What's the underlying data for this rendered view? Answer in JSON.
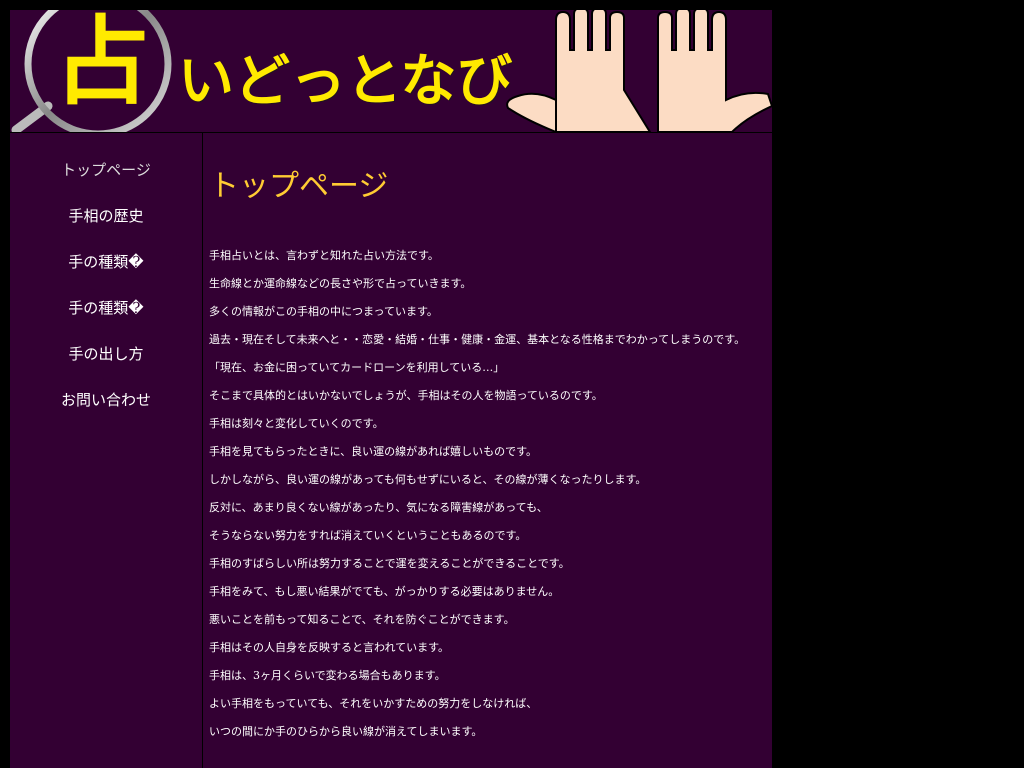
{
  "site": {
    "logo_kanji": "占",
    "logo_text": "いどっとなび",
    "brand_color": "#ffea00",
    "background": "#330033"
  },
  "sidebar": {
    "items": [
      {
        "label": "トップページ"
      },
      {
        "label": "手相の歴史"
      },
      {
        "label": "手の種類�"
      },
      {
        "label": "手の種類�"
      },
      {
        "label": "手の出し方"
      },
      {
        "label": "お問い合わせ"
      }
    ]
  },
  "main": {
    "title": "トップページ",
    "paragraphs": [
      "手相占いとは、言わずと知れた占い方法です。",
      "生命線とか運命線などの長さや形で占っていきます。",
      "多くの情報がこの手相の中につまっています。",
      "過去・現在そして未来へと・・恋愛・結婚・仕事・健康・金運、基本となる性格までわかってしまうのです。",
      "「現在、お金に困っていてカードローンを利用している…」",
      "そこまで具体的とはいかないでしょうが、手相はその人を物語っているのです。",
      "手相は刻々と変化していくのです。",
      "手相を見てもらったときに、良い運の線があれば嬉しいものです。",
      "しかしながら、良い運の線があっても何もせずにいると、その線が薄くなったりします。",
      "反対に、あまり良くない線があったり、気になる障害線があっても、",
      "そうならない努力をすれば消えていくということもあるのです。",
      "手相のすばらしい所は努力することで運を変えることができることです。",
      "手相をみて、もし悪い結果がでても、がっかりする必要はありません。",
      "悪いことを前もって知ることで、それを防ぐことができます。",
      "手相はその人自身を反映すると言われています。",
      "手相は、3ヶ月くらいで変わる場合もあります。",
      "よい手相をもっていても、それをいかすための努力をしなければ、",
      "いつの間にか手のひらから良い線が消えてしまいます。"
    ]
  }
}
